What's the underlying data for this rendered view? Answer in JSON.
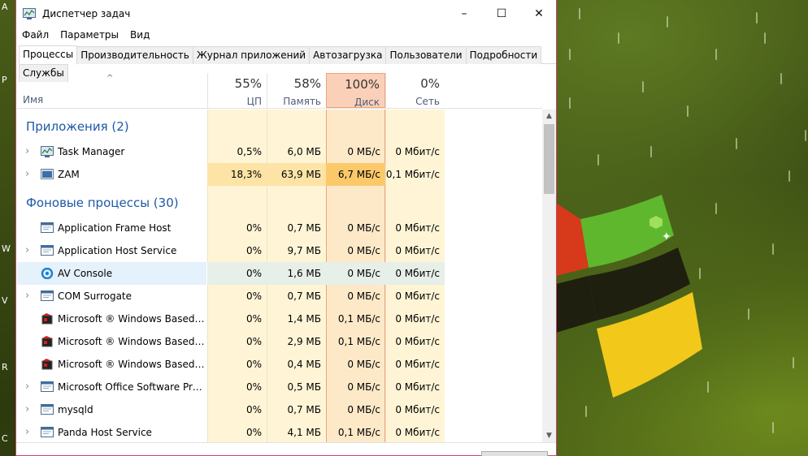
{
  "window": {
    "title": "Диспетчер задач",
    "minimize": "–",
    "maximize": "☐",
    "close": "✕"
  },
  "menu": [
    "Файл",
    "Параметры",
    "Вид"
  ],
  "tabs": [
    "Процессы",
    "Производительность",
    "Журнал приложений",
    "Автозагрузка",
    "Пользователи",
    "Подробности",
    "Службы"
  ],
  "active_tab": "Процессы",
  "header": {
    "sort_arrow": "^",
    "name": "Имя",
    "cpu": {
      "pct": "55%",
      "label": "ЦП"
    },
    "memory": {
      "pct": "58%",
      "label": "Память"
    },
    "disk": {
      "pct": "100%",
      "label": "Диск"
    },
    "network": {
      "pct": "0%",
      "label": "Сеть"
    }
  },
  "groups": {
    "apps": "Приложения (2)",
    "background": "Фоновые процессы (30)"
  },
  "apps": [
    {
      "name": "Task Manager",
      "cpu": "0,5%",
      "mem": "6,0 МБ",
      "disk": "0 МБ/с",
      "net": "0 Мбит/с",
      "icon": "task-manager-icon"
    },
    {
      "name": "ZAM",
      "cpu": "18,3%",
      "mem": "63,9 МБ",
      "disk": "6,7 МБ/с",
      "net": "0,1 Мбит/с",
      "icon": "zam-icon"
    }
  ],
  "processes": [
    {
      "name": "Application Frame Host",
      "cpu": "0%",
      "mem": "0,7 МБ",
      "disk": "0 МБ/с",
      "net": "0 Мбит/с",
      "expandable": false,
      "icon": "window-icon"
    },
    {
      "name": "Application Host Service",
      "cpu": "0%",
      "mem": "9,7 МБ",
      "disk": "0 МБ/с",
      "net": "0 Мбит/с",
      "expandable": true,
      "icon": "window-icon"
    },
    {
      "name": "AV Console",
      "cpu": "0%",
      "mem": "1,6 МБ",
      "disk": "0 МБ/с",
      "net": "0 Мбит/с",
      "expandable": false,
      "icon": "av-console-icon"
    },
    {
      "name": "COM Surrogate",
      "cpu": "0%",
      "mem": "0,7 МБ",
      "disk": "0 МБ/с",
      "net": "0 Мбит/с",
      "expandable": true,
      "icon": "window-icon"
    },
    {
      "name": "Microsoft ® Windows Based Sc...",
      "cpu": "0%",
      "mem": "1,4 МБ",
      "disk": "0,1 МБ/с",
      "net": "0 Мбит/с",
      "expandable": false,
      "icon": "script-host-icon"
    },
    {
      "name": "Microsoft ® Windows Based Sc...",
      "cpu": "0%",
      "mem": "2,9 МБ",
      "disk": "0,1 МБ/с",
      "net": "0 Мбит/с",
      "expandable": false,
      "icon": "script-host-icon"
    },
    {
      "name": "Microsoft ® Windows Based Sc...",
      "cpu": "0%",
      "mem": "0,4 МБ",
      "disk": "0 МБ/с",
      "net": "0 Мбит/с",
      "expandable": false,
      "icon": "script-host-icon"
    },
    {
      "name": "Microsoft Office Software Prote...",
      "cpu": "0%",
      "mem": "0,5 МБ",
      "disk": "0 МБ/с",
      "net": "0 Мбит/с",
      "expandable": true,
      "icon": "window-icon"
    },
    {
      "name": "mysqld",
      "cpu": "0%",
      "mem": "0,7 МБ",
      "disk": "0 МБ/с",
      "net": "0 Мбит/с",
      "expandable": true,
      "icon": "window-icon"
    },
    {
      "name": "Panda Host Service",
      "cpu": "0%",
      "mem": "4,1 МБ",
      "disk": "0,1 МБ/с",
      "net": "0 Мбит/с",
      "expandable": true,
      "icon": "window-icon"
    }
  ],
  "selected_process": "AV Console",
  "colors": {
    "accent_blue": "#1e58a8",
    "heat_light": "#fff5d6",
    "heat_medium": "#fde3a6",
    "heat_strong": "#fbc96a",
    "disk_hot": "#fbd0b8",
    "window_border": "#c44a6a"
  },
  "desktop_side_letters": [
    "A",
    "P",
    "W",
    "V",
    "R",
    "C"
  ]
}
